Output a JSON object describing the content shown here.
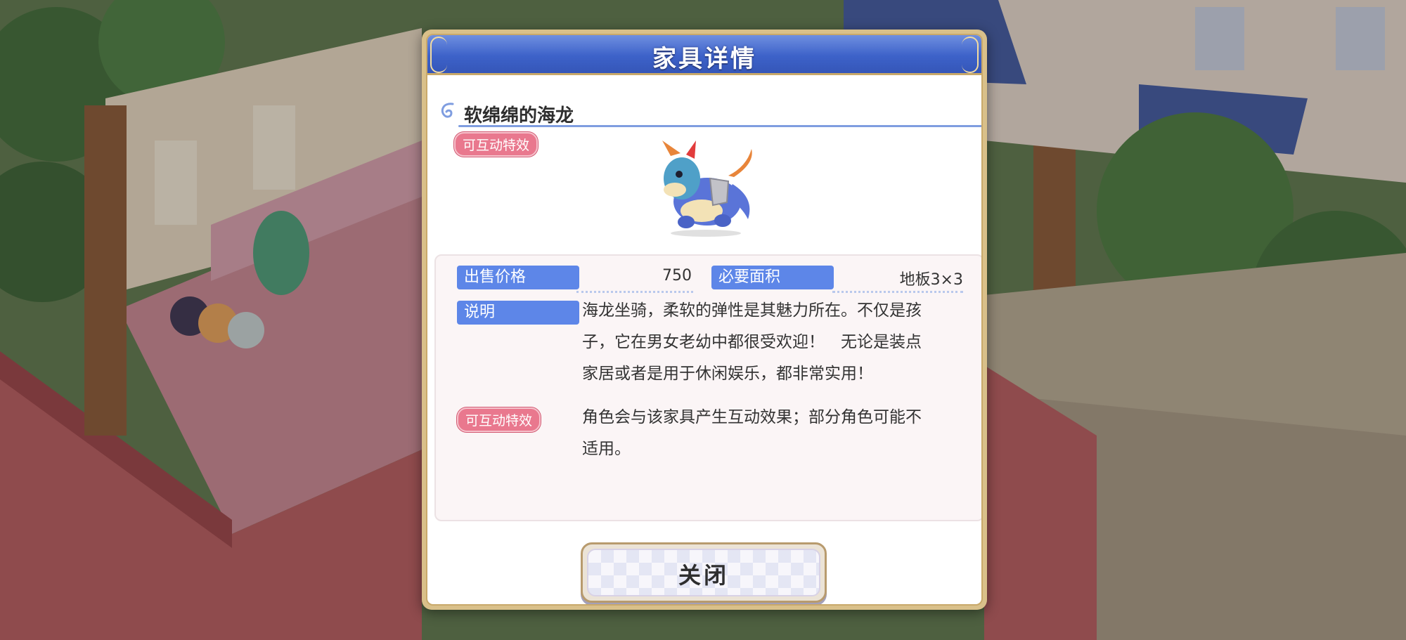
{
  "dialog": {
    "title": "家具详情",
    "item_name": "软绵绵的海龙",
    "interactive_badge": "可互动特效",
    "item_icon": "sea-dragon-plush"
  },
  "info": {
    "price_label": "出售价格",
    "price_value": "750",
    "area_label": "必要面积",
    "area_value": "地板3×3",
    "desc_label": "说明",
    "desc_lines": [
      "海龙坐骑，柔软的弹性是其魅力所在。不仅是孩",
      "子，它在男女老幼中都很受欢迎！　无论是装点",
      "家居或者是用于休闲娱乐，都非常实用！"
    ],
    "effect_label": "可互动特效",
    "effect_lines": [
      "角色会与该家具产生互动效果；部分角色可能不",
      "适用。"
    ]
  },
  "buttons": {
    "close_label": "关闭"
  },
  "colors": {
    "header_blue": "#3d62c9",
    "label_blue": "#5d86e8",
    "badge_pink": "#e9788e",
    "frame_gold": "#c9a96a"
  }
}
